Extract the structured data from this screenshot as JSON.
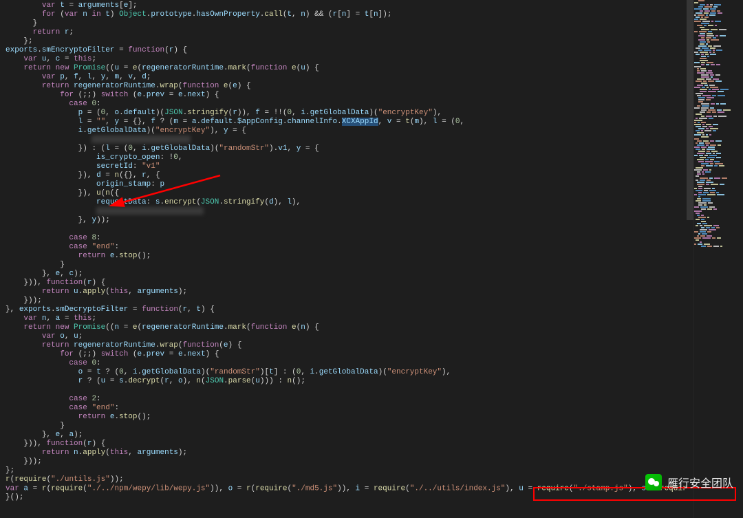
{
  "watermark_text": "雁行安全团队",
  "selection_text": "XCXAppId",
  "code_lines": [
    "        var t = arguments[e];",
    "        for (var n in t) Object.prototype.hasOwnProperty.call(t, n) && (r[n] = t[n]);",
    "      }",
    "      return r;",
    "    };",
    "exports.smEncryptoFilter = function(r) {",
    "    var u, c = this;",
    "    return new Promise((u = e(regeneratorRuntime.mark(function e(u) {",
    "        var p, f, l, y, m, v, d;",
    "        return regeneratorRuntime.wrap(function e(e) {",
    "            for (;;) switch (e.prev = e.next) {",
    "              case 0:",
    "                p = (0, o.default)(JSON.stringify(r)), f = !!(0, i.getGlobalData)(\"encryptKey\"),",
    "                l = \"\", y = {}, f ? (m = a.default.$appConfig.channelInfo.XCXAppId, v = t(m), l = (0,",
    "                i.getGlobalData)(\"encryptKey\"), y = {",
    "                   ████████████████████████",
    "                }) : (l = (0, i.getGlobalData)(\"randomStr\").v1, y = {",
    "                    is_crypto_open: !0,",
    "                    secretId: \"v1\"",
    "                }), d = n({}, r, {",
    "                    origin_stamp: p",
    "                }), u(n({",
    "                    requestData: s.encrypt(JSON.stringify(d), l),",
    "                    ██████████████████████████",
    "                }, y));",
    "",
    "              case 8:",
    "              case \"end\":",
    "                return e.stop();",
    "            }",
    "        }, e, c);",
    "    })), function(r) {",
    "        return u.apply(this, arguments);",
    "    }));",
    "}, exports.smDecryptoFilter = function(r, t) {",
    "    var n, a = this;",
    "    return new Promise((n = e(regeneratorRuntime.mark(function e(n) {",
    "        var o, u;",
    "        return regeneratorRuntime.wrap(function(e) {",
    "            for (;;) switch (e.prev = e.next) {",
    "              case 0:",
    "                o = t ? (0, i.getGlobalData)(\"randomStr\")[t] : (0, i.getGlobalData)(\"encryptKey\"),",
    "                r ? (u = s.decrypt(r, o), n(JSON.parse(u))) : n();",
    "",
    "              case 2:",
    "              case \"end\":",
    "                return e.stop();",
    "            }",
    "        }, e, a);",
    "    })), function(r) {",
    "        return n.apply(this, arguments);",
    "    }));",
    "};",
    "r(require(\"./untils.js\"));",
    "var a = r(require(\"./../npm/wepy/lib/wepy.js\")), o = r(require(\"./md5.js\")), i = require(\"./../utils/index.js\"), u = require(\"./stamp.js\"), s = require(\"./sm-██████████████████████\");",
    "}();"
  ]
}
